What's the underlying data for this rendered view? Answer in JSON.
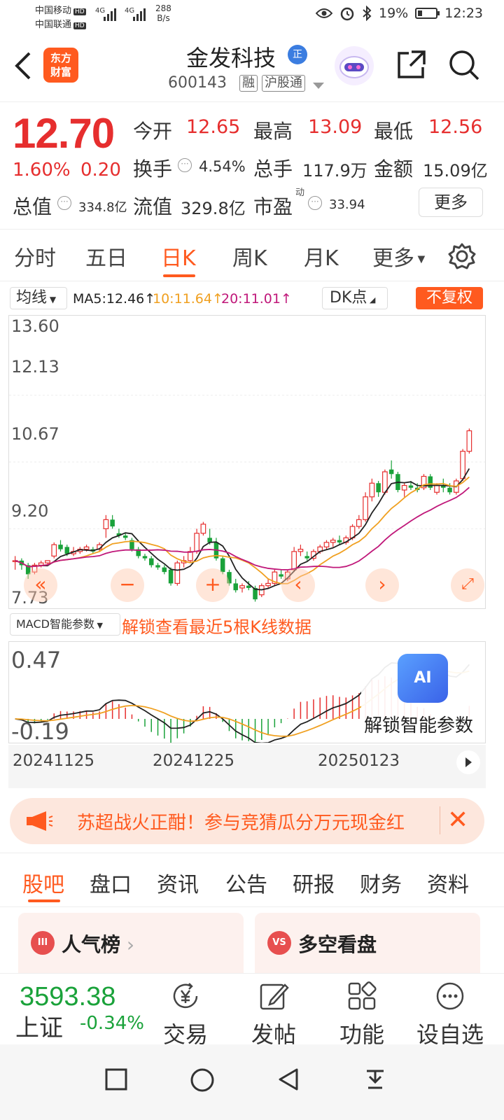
{
  "status": {
    "carrier1": "中国移动",
    "carrier2": "中国联通",
    "hd": "HD",
    "sig1": "4G",
    "sig2": "4G",
    "speed_val": "288",
    "speed_unit": "B/s",
    "battery": "19%",
    "time": "12:23"
  },
  "header": {
    "logo": "东方\n财富",
    "logo_l1": "东方",
    "logo_l2": "财富",
    "name": "金发科技",
    "badge": "正",
    "code": "600143",
    "tag1": "融",
    "tag2": "沪股通"
  },
  "quote": {
    "price": "12.70",
    "pct": "1.60%",
    "change": "0.20",
    "open_label": "今开",
    "open": "12.65",
    "high_label": "最高",
    "high": "13.09",
    "low_label": "最低",
    "low": "12.56",
    "turnover_label": "换手",
    "turnover": "4.54%",
    "volume_label": "总手",
    "volume": "117.9万",
    "amount_label": "金额",
    "amount": "15.09亿",
    "mktcap_label": "总值",
    "mktcap": "334.8亿",
    "float_label": "流值",
    "float": "329.8亿",
    "pe_label": "市盈",
    "pe_sup": "动",
    "pe": "33.94",
    "more": "更多"
  },
  "chart_tabs": [
    "分时",
    "五日",
    "日K",
    "周K",
    "月K",
    "更多"
  ],
  "ma": {
    "selector": "均线",
    "ma5": "MA5:12.46↑",
    "ma10": "10:11.64↑",
    "ma20": "20:11.01↑",
    "dk": "DK点",
    "fuquan": "不复权",
    "colors": {
      "ma5": "#222222",
      "ma10": "#f0a020",
      "ma20": "#c0187a",
      "up": "#e62e2e",
      "down": "#1aa23a",
      "accent": "#ff5a1f"
    }
  },
  "chart_data": {
    "type": "candlestick",
    "y_ticks": [
      "13.60",
      "12.13",
      "10.67",
      "9.20",
      "7.73"
    ],
    "ylim": [
      7.73,
      13.6
    ],
    "x_ticks": [
      "20241125",
      "20241225",
      "20250123"
    ],
    "candles": [
      [
        8.5,
        8.6,
        8.3,
        8.5
      ],
      [
        8.5,
        8.55,
        8.3,
        8.4
      ],
      [
        8.4,
        8.45,
        8.1,
        8.2
      ],
      [
        8.25,
        8.45,
        8.2,
        8.4
      ],
      [
        8.4,
        8.5,
        8.35,
        8.45
      ],
      [
        8.45,
        8.5,
        8.4,
        8.5
      ],
      [
        8.6,
        8.9,
        8.55,
        8.85
      ],
      [
        8.85,
        8.95,
        8.7,
        8.75
      ],
      [
        8.8,
        8.85,
        8.6,
        8.65
      ],
      [
        8.65,
        8.8,
        8.6,
        8.7
      ],
      [
        8.7,
        8.8,
        8.65,
        8.75
      ],
      [
        8.75,
        8.85,
        8.7,
        8.8
      ],
      [
        8.75,
        8.8,
        8.65,
        8.7
      ],
      [
        8.75,
        8.9,
        8.7,
        8.85
      ],
      [
        9.2,
        9.5,
        9.0,
        9.4
      ],
      [
        9.4,
        9.5,
        9.2,
        9.25
      ],
      [
        9.1,
        9.2,
        9.0,
        9.05
      ],
      [
        9.05,
        9.1,
        8.95,
        9.0
      ],
      [
        8.95,
        9.0,
        8.7,
        8.75
      ],
      [
        8.75,
        8.8,
        8.55,
        8.6
      ],
      [
        8.6,
        8.65,
        8.5,
        8.55
      ],
      [
        8.55,
        8.6,
        8.35,
        8.4
      ],
      [
        8.4,
        8.45,
        8.3,
        8.35
      ],
      [
        8.35,
        8.4,
        8.2,
        8.25
      ],
      [
        8.3,
        8.35,
        7.95,
        8.0
      ],
      [
        8.0,
        8.5,
        7.95,
        8.45
      ],
      [
        8.45,
        8.6,
        8.35,
        8.5
      ],
      [
        8.5,
        8.8,
        8.45,
        8.7
      ],
      [
        8.7,
        9.2,
        8.65,
        9.1
      ],
      [
        9.1,
        9.35,
        9.05,
        9.3
      ],
      [
        9.0,
        9.2,
        8.85,
        8.9
      ],
      [
        8.9,
        9.0,
        8.5,
        8.55
      ],
      [
        8.55,
        8.6,
        8.2,
        8.25
      ],
      [
        8.25,
        8.3,
        7.95,
        8.0
      ],
      [
        8.0,
        8.1,
        7.8,
        7.85
      ],
      [
        7.9,
        8.0,
        7.8,
        7.95
      ],
      [
        7.95,
        8.05,
        7.85,
        7.9
      ],
      [
        7.9,
        7.95,
        7.6,
        7.65
      ],
      [
        7.75,
        8.0,
        7.7,
        7.95
      ],
      [
        7.95,
        8.1,
        7.9,
        8.0
      ],
      [
        8.0,
        8.3,
        7.95,
        8.25
      ],
      [
        8.2,
        8.3,
        8.1,
        8.15
      ],
      [
        8.1,
        8.3,
        8.05,
        8.25
      ],
      [
        8.3,
        8.8,
        8.25,
        8.7
      ],
      [
        8.7,
        8.85,
        8.6,
        8.75
      ],
      [
        8.6,
        8.7,
        8.5,
        8.55
      ],
      [
        8.55,
        8.75,
        8.5,
        8.7
      ],
      [
        8.7,
        8.85,
        8.65,
        8.8
      ],
      [
        8.8,
        8.95,
        8.75,
        8.9
      ],
      [
        8.9,
        9.0,
        8.8,
        8.95
      ],
      [
        8.95,
        9.05,
        8.85,
        8.9
      ],
      [
        8.9,
        9.05,
        8.85,
        9.0
      ],
      [
        9.0,
        9.3,
        8.95,
        9.25
      ],
      [
        9.25,
        9.5,
        9.2,
        9.4
      ],
      [
        9.4,
        10.0,
        9.35,
        9.9
      ],
      [
        9.9,
        10.3,
        9.8,
        10.2
      ],
      [
        10.2,
        10.25,
        9.9,
        10.0
      ],
      [
        10.0,
        10.5,
        9.95,
        10.45
      ],
      [
        10.5,
        10.7,
        10.3,
        10.4
      ],
      [
        10.4,
        10.45,
        10.0,
        10.05
      ],
      [
        10.05,
        10.2,
        9.9,
        10.15
      ],
      [
        10.15,
        10.25,
        10.05,
        10.1
      ],
      [
        10.1,
        10.2,
        10.0,
        10.05
      ],
      [
        10.1,
        10.4,
        10.05,
        10.35
      ],
      [
        10.35,
        10.4,
        10.05,
        10.1
      ],
      [
        10.0,
        10.2,
        9.95,
        10.15
      ],
      [
        10.15,
        10.3,
        10.0,
        10.1
      ],
      [
        10.1,
        10.2,
        9.95,
        10.0
      ],
      [
        10.0,
        10.3,
        9.95,
        10.25
      ],
      [
        10.3,
        10.95,
        10.25,
        10.9
      ],
      [
        10.9,
        11.4,
        10.85,
        11.35
      ]
    ],
    "note": "values are [open, high, low, close] read from candle heights against y_ticks"
  },
  "macd": {
    "selector": "MACD智能参数",
    "unlock": "解锁查看最近5根K线数据",
    "y_top": "0.47",
    "y_bot": "-0.19",
    "ai_badge": "AI",
    "ai_text": "解锁智能参数"
  },
  "banner": {
    "text": "苏超战火正酣！参与竞猜瓜分万元现金红"
  },
  "bottom_tabs": [
    "股吧",
    "盘口",
    "资讯",
    "公告",
    "研报",
    "财务",
    "资料"
  ],
  "cards": {
    "left_icon": "III",
    "left_title": "人气榜",
    "right_icon": "VS",
    "right_title": "多空看盘"
  },
  "bottom_bar": {
    "index_value": "3593.38",
    "index_name": "上证",
    "index_pct": "-0.34%",
    "trade": "交易",
    "post": "发帖",
    "func": "功能",
    "watch": "设自选"
  }
}
